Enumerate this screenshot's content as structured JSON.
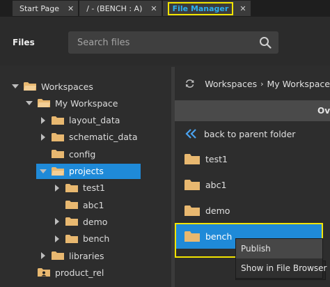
{
  "tabs": [
    {
      "label": "Start Page",
      "close": "✕"
    },
    {
      "label": "/ - (BENCH : A)",
      "close": "✕"
    },
    {
      "label": "File Manager",
      "close": "✕"
    }
  ],
  "header": {
    "title": "Files",
    "search_placeholder": "Search files"
  },
  "tree": [
    {
      "label": "Workspaces",
      "caret": "down",
      "level": 0
    },
    {
      "label": "My Workspace",
      "caret": "down",
      "level": 1
    },
    {
      "label": "layout_data",
      "caret": "right",
      "level": 2
    },
    {
      "label": "schematic_data",
      "caret": "right",
      "level": 2
    },
    {
      "label": "config",
      "caret": "none",
      "level": 2
    },
    {
      "label": "projects",
      "caret": "down",
      "level": 2,
      "selected": true
    },
    {
      "label": "test1",
      "caret": "right",
      "level": 3
    },
    {
      "label": "abc1",
      "caret": "none",
      "level": 3
    },
    {
      "label": "demo",
      "caret": "right",
      "level": 3
    },
    {
      "label": "bench",
      "caret": "right",
      "level": 3
    },
    {
      "label": "libraries",
      "caret": "right",
      "level": 2
    },
    {
      "label": "product_rel",
      "caret": "none",
      "level": 1
    }
  ],
  "breadcrumb": {
    "items": [
      "Workspaces",
      "My Workspace"
    ],
    "separator": "›"
  },
  "column_header": "Ov",
  "back_label": "back to parent folder",
  "files": [
    "test1",
    "abc1",
    "demo",
    "bench"
  ],
  "context_menu": {
    "items": [
      "Publish",
      "Show in File Browser"
    ]
  },
  "colors": {
    "accent": "#1f8ad8",
    "highlight": "#f2e400",
    "folder": "#e8b870",
    "active_tab_text": "#2bb0f0"
  }
}
